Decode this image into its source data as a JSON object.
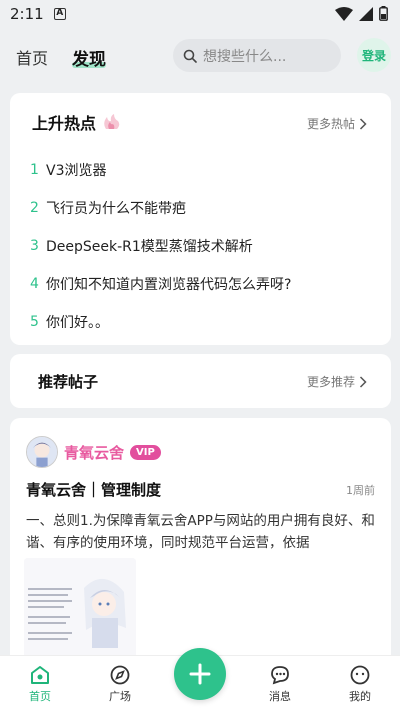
{
  "status_bar": {
    "time": "2:11",
    "notification_icon": "A"
  },
  "header": {
    "tabs": [
      {
        "label": "首页"
      },
      {
        "label": "发现"
      }
    ],
    "search_placeholder": "想搜些什么...",
    "login_label": "登录"
  },
  "hot": {
    "title": "上升热点",
    "more_label": "更多热帖",
    "items": [
      {
        "num": "1",
        "text": "V3浏览器"
      },
      {
        "num": "2",
        "text": "飞行员为什么不能带疤"
      },
      {
        "num": "3",
        "text": "DeepSeek-R1模型蒸馏技术解析"
      },
      {
        "num": "4",
        "text": "你们知不知道内置浏览器代码怎么弄呀?"
      },
      {
        "num": "5",
        "text": "你们好。。"
      }
    ]
  },
  "recommend": {
    "title": "推荐帖子",
    "more_label": "更多推荐"
  },
  "post": {
    "author": "青氧云舍",
    "badge": "VIP",
    "title": "青氧云舍｜管理制度",
    "time": "1周前",
    "body": "一、总则1.为保障青氧云舍APP与网站的用户拥有良好、和谐、有序的使用环境，同时规范平台运营，依据"
  },
  "bottom_nav": [
    {
      "label": "首页"
    },
    {
      "label": "广场"
    },
    {
      "label": "消息"
    },
    {
      "label": "我的"
    }
  ],
  "colors": {
    "accent": "#2ec28c",
    "vip": "#e24e9d"
  }
}
